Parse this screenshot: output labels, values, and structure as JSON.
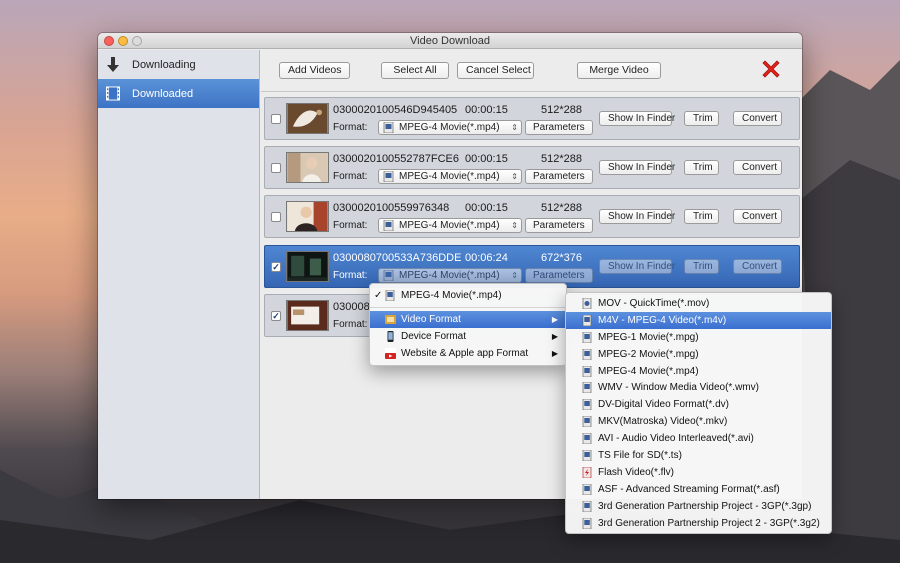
{
  "window": {
    "title": "Video Download"
  },
  "sidebar": {
    "items": [
      {
        "label": "Downloading",
        "icon": "download-arrow-icon",
        "active": false
      },
      {
        "label": "Downloaded",
        "icon": "film-icon",
        "active": true
      }
    ]
  },
  "toolbar": {
    "add_videos": "Add Videos",
    "select_all": "Select All",
    "cancel_select": "Cancel Select",
    "merge_video": "Merge Video",
    "close_icon": "red-x-icon"
  },
  "rows": [
    {
      "name": "0300020100546D945405",
      "duration": "00:00:15",
      "resolution": "512*288",
      "format_label": "Format:",
      "format": "MPEG-4 Movie(*.mp4)",
      "checked": false,
      "selected": false,
      "parameters": "Parameters",
      "show_in_finder": "Show In Finder",
      "trim": "Trim",
      "convert": "Convert"
    },
    {
      "name": "0300020100552787FCE6",
      "duration": "00:00:15",
      "resolution": "512*288",
      "format_label": "Format:",
      "format": "MPEG-4 Movie(*.mp4)",
      "checked": false,
      "selected": false,
      "parameters": "Parameters",
      "show_in_finder": "Show In Finder",
      "trim": "Trim",
      "convert": "Convert"
    },
    {
      "name": "0300020100559976348",
      "duration": "00:00:15",
      "resolution": "512*288",
      "format_label": "Format:",
      "format": "MPEG-4 Movie(*.mp4)",
      "checked": false,
      "selected": false,
      "parameters": "Parameters",
      "show_in_finder": "Show In Finder",
      "trim": "Trim",
      "convert": "Convert"
    },
    {
      "name": "0300080700533A736DDE",
      "duration": "00:06:24",
      "resolution": "672*376",
      "format_label": "Format:",
      "format": "MPEG-4 Movie(*.mp4)",
      "checked": true,
      "selected": true,
      "parameters": "Parameters",
      "show_in_finder": "Show In Finder",
      "trim": "Trim",
      "convert": "Convert"
    },
    {
      "name": "030008",
      "duration": "",
      "resolution": "",
      "format_label": "Format:",
      "format": "",
      "checked": true,
      "selected": false,
      "parameters": "",
      "show_in_finder": "",
      "trim": "",
      "convert": ""
    }
  ],
  "format_menu": {
    "items": [
      {
        "label": "MPEG-4 Movie(*.mp4)",
        "checked": true,
        "has_submenu": false
      },
      {
        "label": "Video Format",
        "checked": false,
        "has_submenu": true,
        "highlighted": true
      },
      {
        "label": "Device Format",
        "checked": false,
        "has_submenu": true
      },
      {
        "label": "Website & Apple app Format",
        "checked": false,
        "has_submenu": true
      }
    ]
  },
  "video_format_submenu": {
    "items": [
      {
        "label": "MOV - QuickTime(*.mov)"
      },
      {
        "label": "M4V - MPEG-4 Video(*.m4v)",
        "highlighted": true
      },
      {
        "label": "MPEG-1 Movie(*.mpg)"
      },
      {
        "label": "MPEG-2 Movie(*.mpg)"
      },
      {
        "label": "MPEG-4 Movie(*.mp4)"
      },
      {
        "label": "WMV - Window Media Video(*.wmv)"
      },
      {
        "label": "DV-Digital Video Format(*.dv)"
      },
      {
        "label": "MKV(Matroska) Video(*.mkv)"
      },
      {
        "label": "AVI - Audio Video Interleaved(*.avi)"
      },
      {
        "label": "TS File for SD(*.ts)"
      },
      {
        "label": "Flash Video(*.flv)"
      },
      {
        "label": "ASF - Advanced Streaming Format(*.asf)"
      },
      {
        "label": "3rd Generation Partnership Project - 3GP(*.3gp)"
      },
      {
        "label": "3rd Generation Partnership Project 2 - 3GP(*.3g2)"
      }
    ]
  },
  "colors": {
    "accent": "#3d73c4",
    "selected_row": "#3f74c4",
    "close_red": "#e2231a"
  }
}
